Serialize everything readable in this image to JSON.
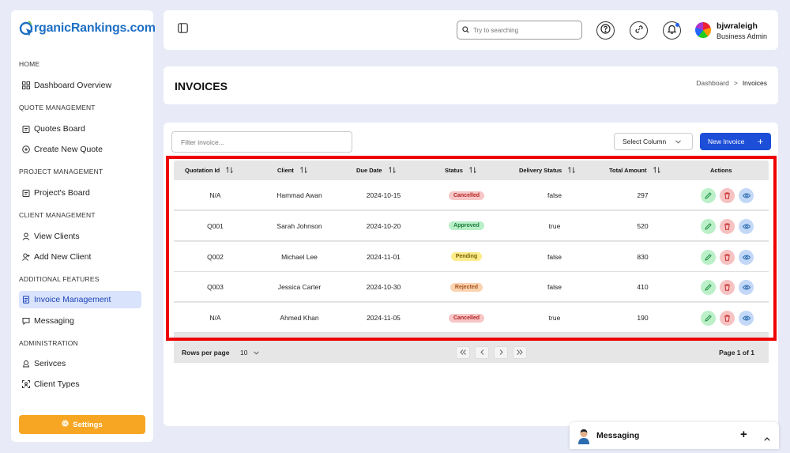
{
  "brand": {
    "logo_text": "rganicRankings.com"
  },
  "sidebar": {
    "sections": [
      {
        "title": "HOME",
        "items": [
          {
            "label": "Dashboard Overview",
            "icon": "grid-icon"
          }
        ]
      },
      {
        "title": "QUOTE MANAGEMENT",
        "items": [
          {
            "label": "Quotes Board",
            "icon": "clipboard-icon"
          },
          {
            "label": "Create New Quote",
            "icon": "plus-circle-icon"
          }
        ]
      },
      {
        "title": "PROJECT MANAGEMENT",
        "items": [
          {
            "label": "Project's Board",
            "icon": "clipboard-icon"
          }
        ]
      },
      {
        "title": "CLIENT MANAGEMENT",
        "items": [
          {
            "label": "View Clients",
            "icon": "user-icon"
          },
          {
            "label": "Add New Client",
            "icon": "user-plus-icon"
          }
        ]
      },
      {
        "title": "ADDITIONAL FEATURES",
        "items": [
          {
            "label": "Invoice Management",
            "icon": "document-icon",
            "active": true
          },
          {
            "label": "Messaging",
            "icon": "chat-icon"
          }
        ]
      },
      {
        "title": "ADMINISTRATION",
        "items": [
          {
            "label": "Serivces",
            "icon": "services-icon"
          },
          {
            "label": "Client Types",
            "icon": "client-types-icon"
          }
        ]
      }
    ],
    "settings_label": "Settings"
  },
  "topbar": {
    "search_placeholder": "Try to searching",
    "user": {
      "name": "bjwraleigh",
      "role": "Business Admin"
    }
  },
  "header": {
    "title": "INVOICES",
    "breadcrumb": {
      "parent": "Dashboard",
      "separator": ">",
      "current": "Invoices"
    }
  },
  "toolbar": {
    "filter_placeholder": "Filter invoice...",
    "select_column_label": "Select Column",
    "new_invoice_label": "New Invoice",
    "new_invoice_icon": "+"
  },
  "table": {
    "columns": [
      "Quotation Id",
      "Client",
      "Due Date",
      "Status",
      "Delivery Status",
      "Total Amount",
      "Actions"
    ],
    "rows": [
      {
        "quotation_id": "N/A",
        "client": "Hammad Awan",
        "due_date": "2024-10-15",
        "status": "Cancelled",
        "delivery_status": "false",
        "total": "297"
      },
      {
        "quotation_id": "Q001",
        "client": "Sarah Johnson",
        "due_date": "2024-10-20",
        "status": "Approved",
        "delivery_status": "true",
        "total": "520"
      },
      {
        "quotation_id": "Q002",
        "client": "Michael Lee",
        "due_date": "2024-11-01",
        "status": "Pending",
        "delivery_status": "false",
        "total": "830"
      },
      {
        "quotation_id": "Q003",
        "client": "Jessica Carter",
        "due_date": "2024-10-30",
        "status": "Rejected",
        "delivery_status": "false",
        "total": "410"
      },
      {
        "quotation_id": "N/A",
        "client": "Ahmed Khan",
        "due_date": "2024-11-05",
        "status": "Cancelled",
        "delivery_status": "true",
        "total": "190"
      }
    ]
  },
  "status_colors": {
    "Cancelled": {
      "bg": "#f7c6c6",
      "fg": "#b42323"
    },
    "Approved": {
      "bg": "#b8efc7",
      "fg": "#1b7a3a"
    },
    "Pending": {
      "bg": "#fbeb8a",
      "fg": "#7a6205"
    },
    "Rejected": {
      "bg": "#fbd3b0",
      "fg": "#a5511a"
    }
  },
  "pagination": {
    "rows_per_page_label": "Rows per page",
    "rows_per_page_value": "10",
    "page_info": "Page 1 of 1"
  },
  "messaging_widget": {
    "title": "Messaging",
    "plus": "+"
  },
  "colors": {
    "accent": "#1d4ed8",
    "settings": "#f6a623",
    "active_nav_bg": "#d9e3fb",
    "highlight": "#e00000"
  }
}
